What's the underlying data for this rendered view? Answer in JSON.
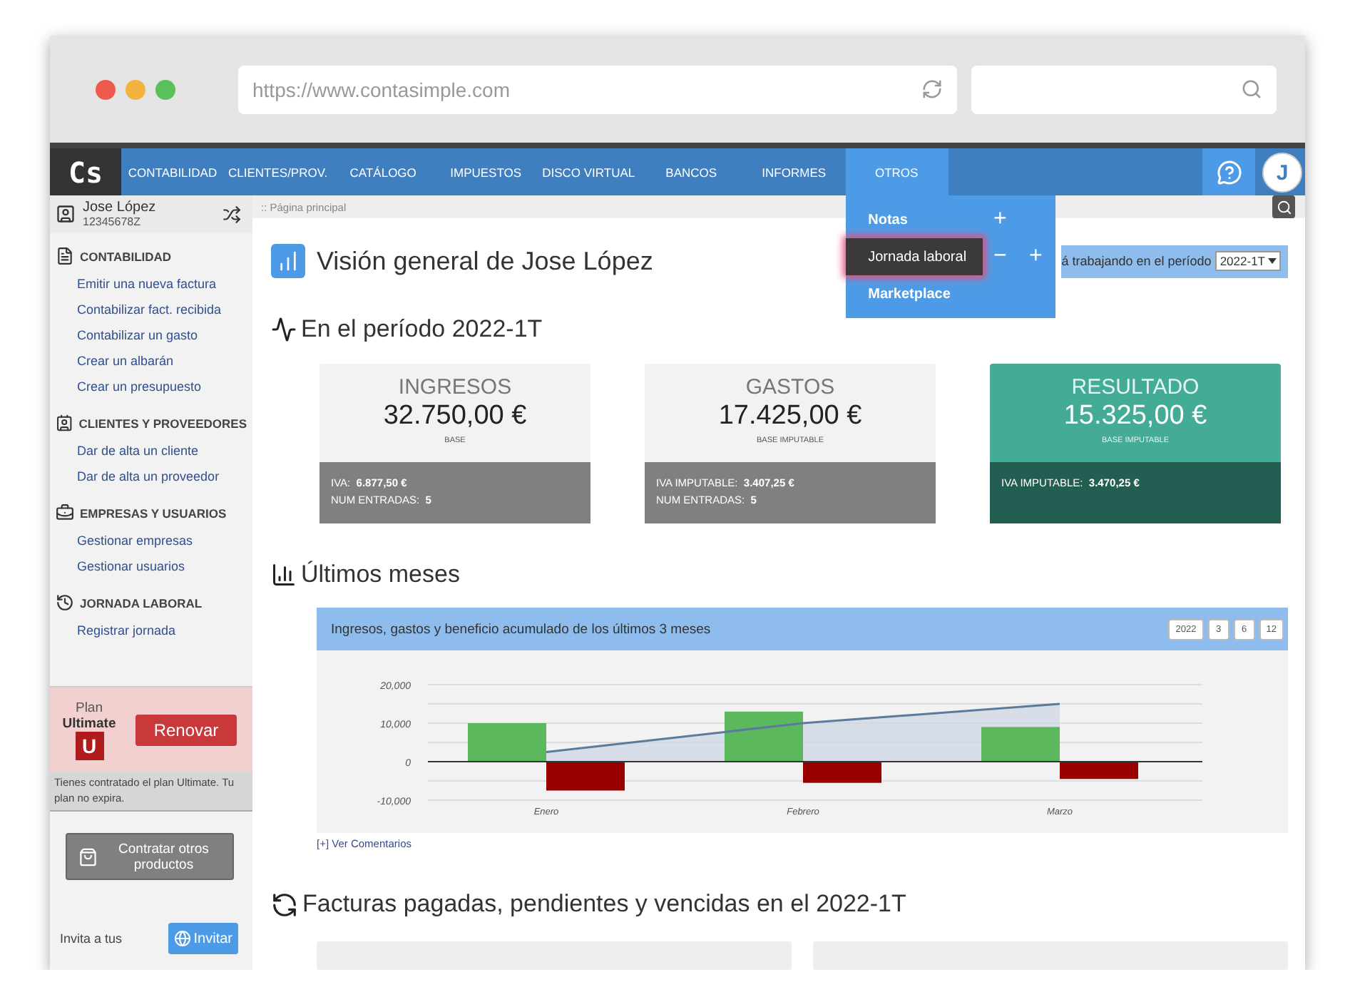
{
  "browser": {
    "url": "https://www.contasimple.com"
  },
  "nav": {
    "logo": "Cs",
    "items": [
      {
        "label": "CONTABILIDAD",
        "selected": false
      },
      {
        "label": "CLIENTES/PROV.",
        "selected": false
      },
      {
        "label": "CATÁLOGO",
        "selected": false
      },
      {
        "label": "IMPUESTOS",
        "selected": false
      },
      {
        "label": "DISCO VIRTUAL",
        "selected": false
      },
      {
        "label": "BANCOS",
        "selected": false
      },
      {
        "label": "INFORMES",
        "selected": false
      },
      {
        "label": "OTROS",
        "selected": true
      }
    ],
    "avatar": "J"
  },
  "dropdown": {
    "items": [
      {
        "label": "Notas",
        "selected": false,
        "actions": [
          "+"
        ]
      },
      {
        "label": "Jornada laboral",
        "selected": true,
        "actions": [
          "−",
          "+"
        ]
      },
      {
        "label": "Marketplace",
        "selected": false
      }
    ]
  },
  "sidebar": {
    "user": {
      "name": "Jose López",
      "id": "12345678Z"
    },
    "sections": [
      {
        "title": "CONTABILIDAD",
        "links": [
          "Emitir una nueva factura",
          "Contabilizar fact. recibida",
          "Contabilizar un gasto",
          "Crear un albarán",
          "Crear un presupuesto"
        ]
      },
      {
        "title": "CLIENTES Y PROVEEDORES",
        "links": [
          "Dar de alta un cliente",
          "Dar de alta un proveedor"
        ]
      },
      {
        "title": "EMPRESAS Y USUARIOS",
        "links": [
          "Gestionar empresas",
          "Gestionar usuarios"
        ]
      },
      {
        "title": "JORNADA LABORAL",
        "links": [
          "Registrar jornada"
        ]
      }
    ],
    "plan": {
      "label": "Plan",
      "name": "Ultimate",
      "badge": "U",
      "button": "Renovar",
      "note": "Tienes contratado el plan Ultimate. Tu plan no expira."
    },
    "contract_button": "Contratar otros productos",
    "invite_text": "Invita a tus",
    "invite_button": "Invitar"
  },
  "breadcrumb": ":: Página principal",
  "overview": {
    "title": "Visión general de Jose López",
    "period_label": "á trabajando en el período",
    "period_value": "2022-1T"
  },
  "period_heading": "En el período 2022-1T",
  "cards": [
    {
      "title": "INGRESOS",
      "amount": "32.750,00 €",
      "base": "BASE",
      "highlighted": false,
      "details": [
        {
          "label": "IVA:",
          "value": "6.877,50 €"
        },
        {
          "label": "NUM ENTRADAS:",
          "value": "5"
        }
      ]
    },
    {
      "title": "GASTOS",
      "amount": "17.425,00 €",
      "base": "BASE IMPUTABLE",
      "highlighted": false,
      "details": [
        {
          "label": "IVA IMPUTABLE:",
          "value": "3.407,25 €"
        },
        {
          "label": "NUM ENTRADAS:",
          "value": "5"
        }
      ]
    },
    {
      "title": "RESULTADO",
      "amount": "15.325,00 €",
      "base": "BASE IMPUTABLE",
      "highlighted": true,
      "details": [
        {
          "label": "IVA IMPUTABLE:",
          "value": "3.470,25 €"
        }
      ]
    }
  ],
  "months_heading": "Últimos meses",
  "chart_panel": {
    "title": "Ingresos, gastos y beneficio acumulado de los últimos 3 meses",
    "range_buttons": [
      "2022",
      "3",
      "6",
      "12"
    ],
    "chart_data": {
      "type": "bar",
      "categories": [
        "Enero",
        "Febrero",
        "Marzo"
      ],
      "series": [
        {
          "type": "bar",
          "color": "#5cb85c",
          "values": [
            10000,
            13000,
            9000
          ]
        },
        {
          "type": "bar",
          "color": "#990000",
          "values": [
            -7500,
            -5500,
            -4500
          ]
        },
        {
          "type": "line",
          "color": "#5b7a9c",
          "values": [
            2500,
            10000,
            15000
          ]
        }
      ],
      "stacked": false,
      "ylim": [
        -10000,
        20000
      ],
      "yticks": [
        {
          "value": -10000,
          "label": "-10,000"
        },
        {
          "value": 0,
          "label": "0"
        },
        {
          "value": 10000,
          "label": "10,000"
        },
        {
          "value": 20000,
          "label": "20,000"
        }
      ]
    }
  },
  "comments_link": "[+] Ver Comentarios",
  "invoices_heading": "Facturas pagadas, pendientes y vencidas en el 2022-1T"
}
